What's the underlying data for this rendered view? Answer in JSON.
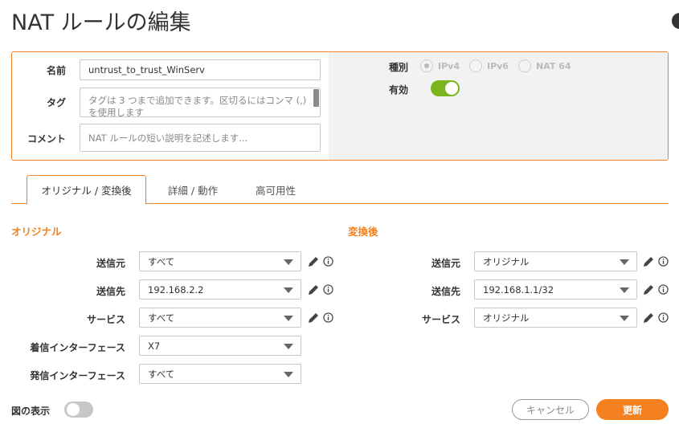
{
  "title": "NAT ルールの編集",
  "form": {
    "name_label": "名前",
    "name_value": "untrust_to_trust_WinServ",
    "tag_label": "タグ",
    "tag_placeholder": "タグは 3 つまで追加できます。区切るにはコンマ (,) を使用します",
    "comment_label": "コメント",
    "comment_placeholder": "NAT ルールの短い説明を記述します...",
    "type_label": "種別",
    "type_options": [
      "IPv4",
      "IPv6",
      "NAT 64"
    ],
    "type_selected": "IPv4",
    "enable_label": "有効",
    "enable_on": true
  },
  "tabs": [
    {
      "label": "オリジナル / 変換後",
      "active": true
    },
    {
      "label": "詳細 / 動作",
      "active": false
    },
    {
      "label": "高可用性",
      "active": false
    }
  ],
  "original": {
    "title": "オリジナル",
    "rows": [
      {
        "label": "送信元",
        "value": "すべて"
      },
      {
        "label": "送信先",
        "value": "192.168.2.2"
      },
      {
        "label": "サービス",
        "value": "すべて"
      },
      {
        "label": "着信インターフェース",
        "value": "X7"
      },
      {
        "label": "発信インターフェース",
        "value": "すべて"
      }
    ]
  },
  "translated": {
    "title": "変換後",
    "rows": [
      {
        "label": "送信元",
        "value": "オリジナル"
      },
      {
        "label": "送信先",
        "value": "192.168.1.1/32"
      },
      {
        "label": "サービス",
        "value": "オリジナル"
      }
    ]
  },
  "footer": {
    "diagram_label": "図の表示",
    "diagram_on": false,
    "cancel_label": "キャンセル",
    "update_label": "更新"
  },
  "colors": {
    "accent": "#f48020",
    "toggle_on": "#7ab51d"
  }
}
